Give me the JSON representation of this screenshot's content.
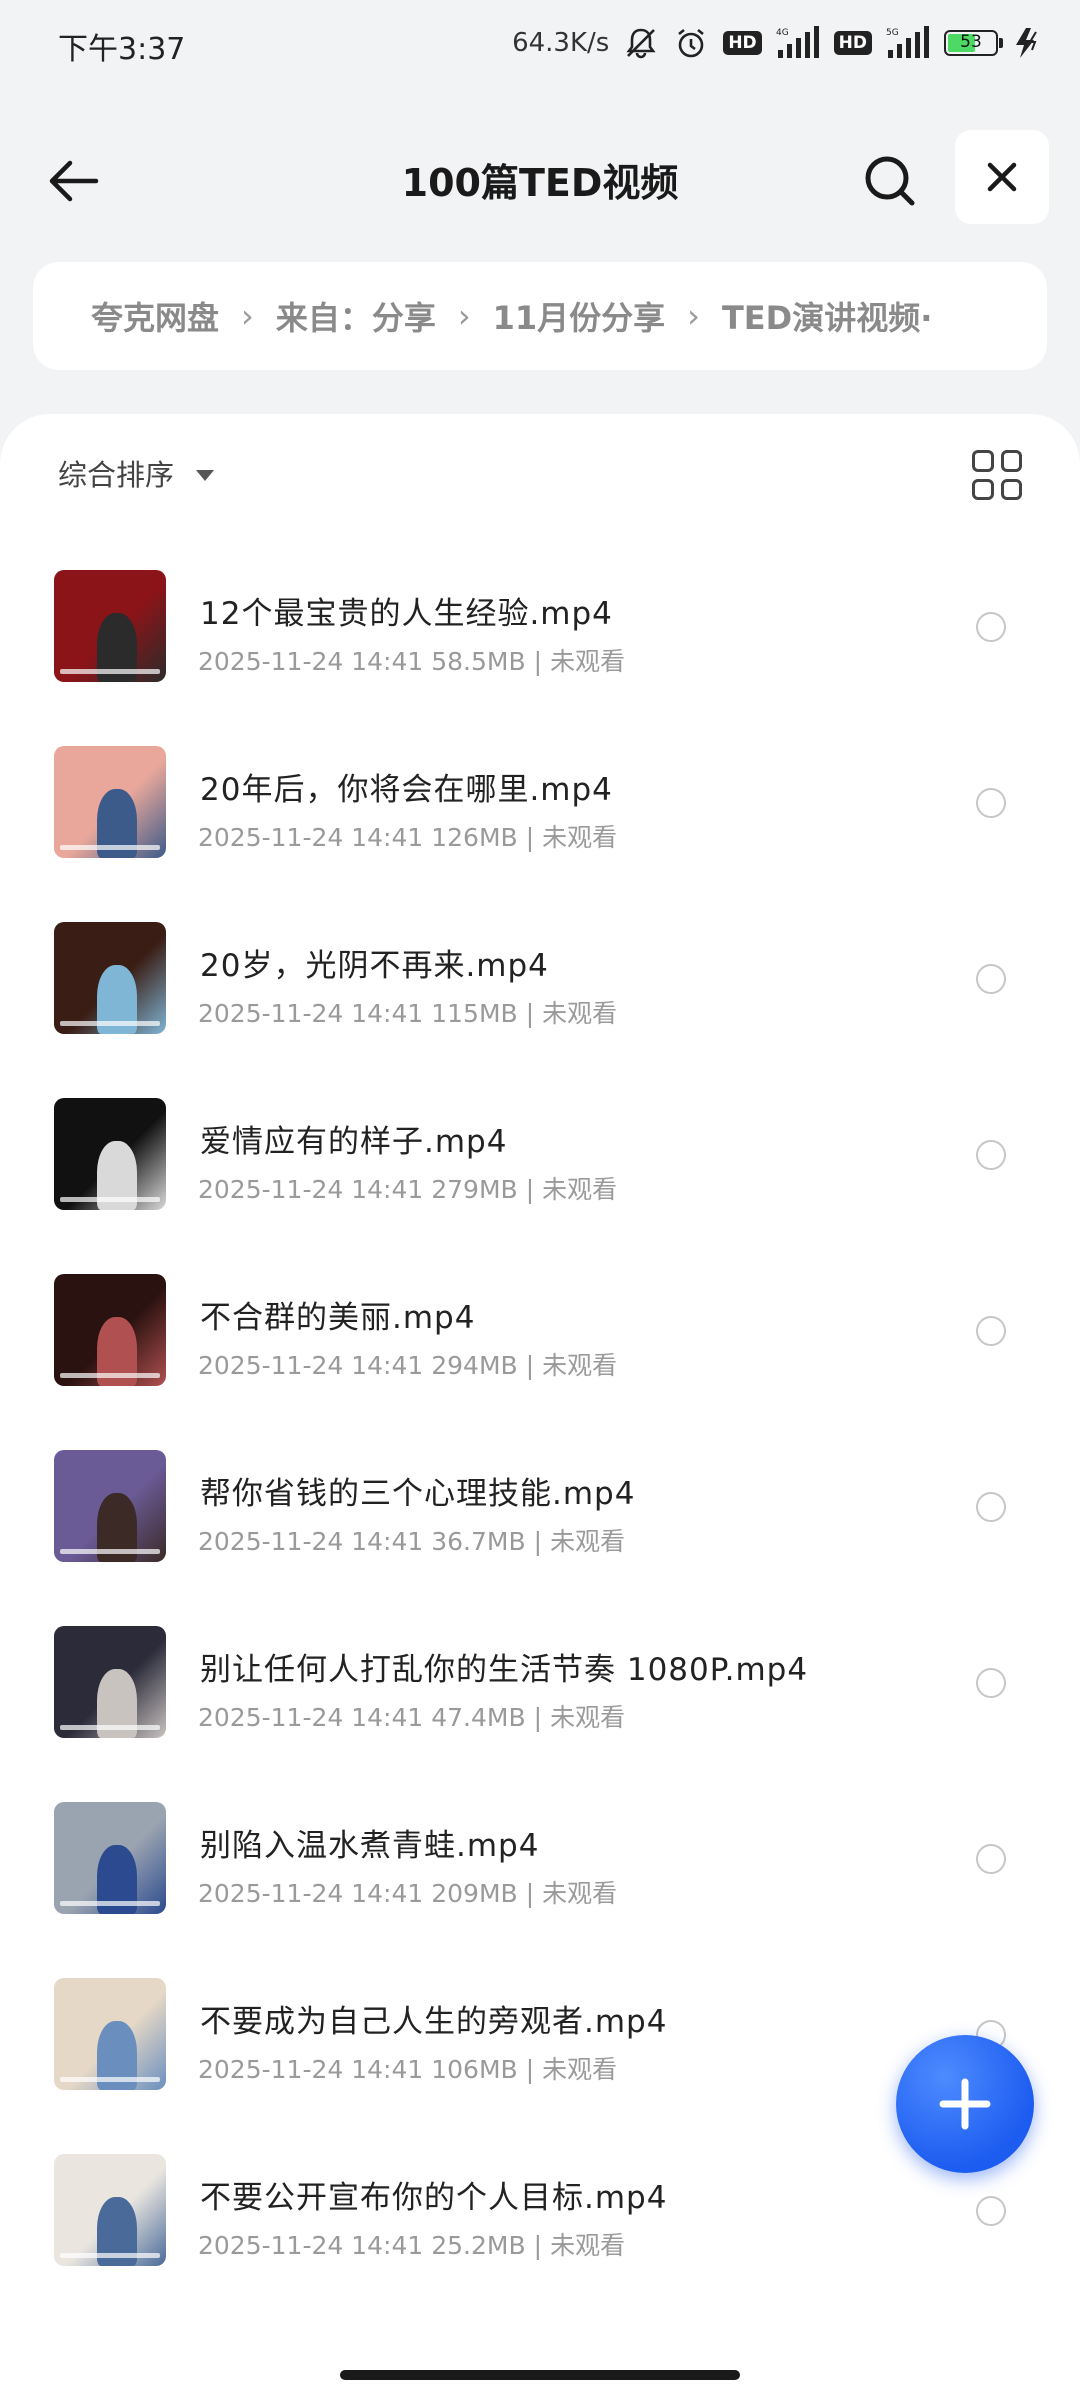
{
  "status_bar": {
    "time": "下午3:37",
    "net_speed": "64.3K/s",
    "hd_badge": "HD",
    "battery_level": "53",
    "icons": [
      "mute-bell-icon",
      "alarm-icon",
      "signal-4g-icon",
      "signal-5g-icon",
      "battery-icon",
      "charging-icon"
    ]
  },
  "header": {
    "title": "100篇TED视频",
    "back_icon": "arrow-left-icon",
    "search_icon": "search-icon",
    "close_icon": "close-icon"
  },
  "breadcrumb": [
    "夸克网盘",
    "来自：分享",
    "11月份分享",
    "TED演讲视频·"
  ],
  "sort": {
    "label": "综合排序",
    "view_toggle_icon": "grid-view-icon"
  },
  "files": [
    {
      "name": "12个最宝贵的人生经验.mp4",
      "date": "2025-11-24 14:41",
      "size": "58.5MB",
      "status": "未观看",
      "thumb_colors": [
        "#8a1418",
        "#2b2b2b"
      ]
    },
    {
      "name": "20年后，你将会在哪里.mp4",
      "date": "2025-11-24 14:41",
      "size": "126MB",
      "status": "未观看",
      "thumb_colors": [
        "#e8a79a",
        "#3c5a8a"
      ]
    },
    {
      "name": "20岁，光阴不再来.mp4",
      "date": "2025-11-24 14:41",
      "size": "115MB",
      "status": "未观看",
      "thumb_colors": [
        "#3a1d14",
        "#7fb6d6"
      ]
    },
    {
      "name": "爱情应有的样子.mp4",
      "date": "2025-11-24 14:41",
      "size": "279MB",
      "status": "未观看",
      "thumb_colors": [
        "#111111",
        "#d9d9d9"
      ]
    },
    {
      "name": "不合群的美丽.mp4",
      "date": "2025-11-24 14:41",
      "size": "294MB",
      "status": "未观看",
      "thumb_colors": [
        "#2a1210",
        "#b05050"
      ]
    },
    {
      "name": "帮你省钱的三个心理技能.mp4",
      "date": "2025-11-24 14:41",
      "size": "36.7MB",
      "status": "未观看",
      "thumb_colors": [
        "#6a5a96",
        "#3b2a26"
      ]
    },
    {
      "name": "别让任何人打乱你的生活节奏 1080P.mp4",
      "date": "2025-11-24 14:41",
      "size": "47.4MB",
      "status": "未观看",
      "thumb_colors": [
        "#2b2b3a",
        "#c9c3c0"
      ]
    },
    {
      "name": "别陷入温水煮青蛙.mp4",
      "date": "2025-11-24 14:41",
      "size": "209MB",
      "status": "未观看",
      "thumb_colors": [
        "#9aa3b0",
        "#2b4a8f"
      ]
    },
    {
      "name": "不要成为自己人生的旁观者.mp4",
      "date": "2025-11-24 14:41",
      "size": "106MB",
      "status": "未观看",
      "thumb_colors": [
        "#e6d8c6",
        "#6a8fbf"
      ]
    },
    {
      "name": "不要公开宣布你的个人目标.mp4",
      "date": "2025-11-24 14:41",
      "size": "25.2MB",
      "status": "未观看",
      "thumb_colors": [
        "#eae6df",
        "#4a6a9a"
      ]
    }
  ],
  "fab_icon": "plus-icon"
}
